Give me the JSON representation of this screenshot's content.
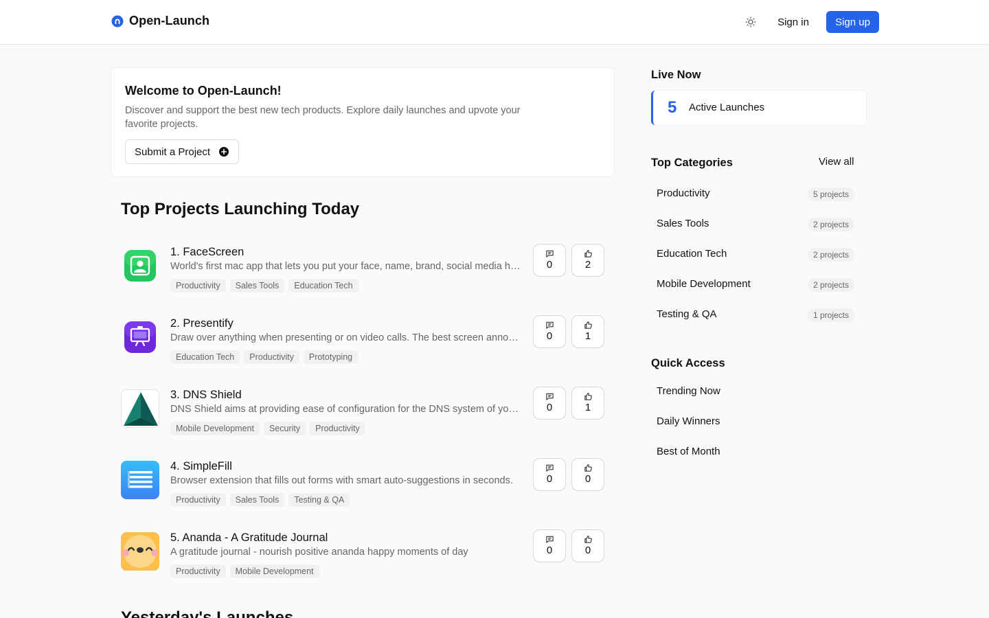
{
  "header": {
    "brand": "Open-Launch",
    "signin_label": "Sign in",
    "signup_label": "Sign up",
    "accent_color": "#2563eb"
  },
  "welcome": {
    "title": "Welcome to Open-Launch!",
    "description": "Discover and support the best new tech products. Explore daily launches and upvote your favorite projects.",
    "submit_label": "Submit a Project"
  },
  "main": {
    "section_title": "Top Projects Launching Today",
    "next_section_title": "Yesterday's Launches",
    "projects": [
      {
        "name": "1. FaceScreen",
        "description": "World's first mac app that lets you put your face, name, brand, social media handles on your screen recordings",
        "tags": [
          "Productivity",
          "Sales Tools",
          "Education Tech"
        ],
        "comments": "0",
        "votes": "2",
        "icon": "facescreen-logo"
      },
      {
        "name": "2. Presentify",
        "description": "Draw over anything when presenting or on video calls. The best screen annotation app for Mac.",
        "tags": [
          "Education Tech",
          "Productivity",
          "Prototyping"
        ],
        "comments": "0",
        "votes": "1",
        "icon": "presentify-logo"
      },
      {
        "name": "3. DNS Shield",
        "description": "DNS Shield aims at providing ease of configuration for the DNS system of your Mac and iPhone devices.",
        "tags": [
          "Mobile Development",
          "Security",
          "Productivity"
        ],
        "comments": "0",
        "votes": "1",
        "icon": "dns-shield-logo"
      },
      {
        "name": "4. SimpleFill",
        "description": "Browser extension that fills out forms with smart auto-suggestions in seconds.",
        "tags": [
          "Productivity",
          "Sales Tools",
          "Testing & QA"
        ],
        "comments": "0",
        "votes": "0",
        "icon": "simplefill-logo"
      },
      {
        "name": "5. Ananda - A Gratitude Journal",
        "description": "A gratitude journal - nourish positive ananda happy moments of day",
        "tags": [
          "Productivity",
          "Mobile Development"
        ],
        "comments": "0",
        "votes": "0",
        "icon": "ananda-logo"
      }
    ]
  },
  "sidebar": {
    "live_title": "Live Now",
    "live_count": "5",
    "live_label": "Active Launches",
    "categories_title": "Top Categories",
    "view_all_label": "View all",
    "categories": [
      {
        "name": "Productivity",
        "count": "5 projects"
      },
      {
        "name": "Sales Tools",
        "count": "2 projects"
      },
      {
        "name": "Education Tech",
        "count": "2 projects"
      },
      {
        "name": "Mobile Development",
        "count": "2 projects"
      },
      {
        "name": "Testing & QA",
        "count": "1 projects"
      }
    ],
    "quick_access_title": "Quick Access",
    "quick_access": [
      {
        "label": "Trending Now"
      },
      {
        "label": "Daily Winners"
      },
      {
        "label": "Best of Month"
      }
    ]
  }
}
